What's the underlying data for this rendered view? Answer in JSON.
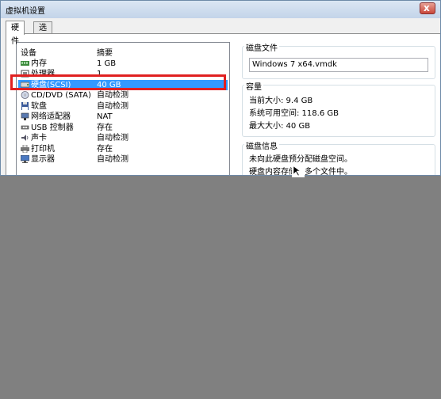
{
  "window": {
    "title": "虚拟机设置",
    "close_label": "x"
  },
  "tabs": [
    {
      "label": "硬件"
    },
    {
      "label": "选项"
    }
  ],
  "device_list": {
    "col_device": "设备",
    "col_summary": "摘要",
    "items": [
      {
        "name": "内存",
        "summary": "1 GB",
        "icon": "memory-icon"
      },
      {
        "name": "处理器",
        "summary": "1",
        "icon": "processor-icon"
      },
      {
        "name": "硬盘(SCSI)",
        "summary": "40 GB",
        "icon": "harddisk-icon",
        "selected": true
      },
      {
        "name": "CD/DVD (SATA)",
        "summary": "自动检测",
        "icon": "cd-dvd-icon"
      },
      {
        "name": "软盘",
        "summary": "自动检测",
        "icon": "floppy-icon"
      },
      {
        "name": "网络适配器",
        "summary": "NAT",
        "icon": "network-icon"
      },
      {
        "name": "USB 控制器",
        "summary": "存在",
        "icon": "usb-icon"
      },
      {
        "name": "声卡",
        "summary": "自动检测",
        "icon": "sound-icon"
      },
      {
        "name": "打印机",
        "summary": "存在",
        "icon": "printer-icon"
      },
      {
        "name": "显示器",
        "summary": "自动检测",
        "icon": "display-icon"
      }
    ]
  },
  "disk_file": {
    "title": "磁盘文件",
    "value": "Windows 7 x64.vmdk"
  },
  "capacity": {
    "title": "容量",
    "current_size": "当前大小: 9.4 GB",
    "system_free": "系统可用空间: 118.6 GB",
    "max_size": "最大大小: 40 GB"
  },
  "disk_info": {
    "title": "磁盘信息",
    "line1": "未向此硬盘预分配磁盘空间。",
    "line2": "硬盘内容存储在多个文件中。"
  },
  "colors": {
    "selection": "#3399ff",
    "highlight_border": "#e02020",
    "background": "#808080"
  }
}
